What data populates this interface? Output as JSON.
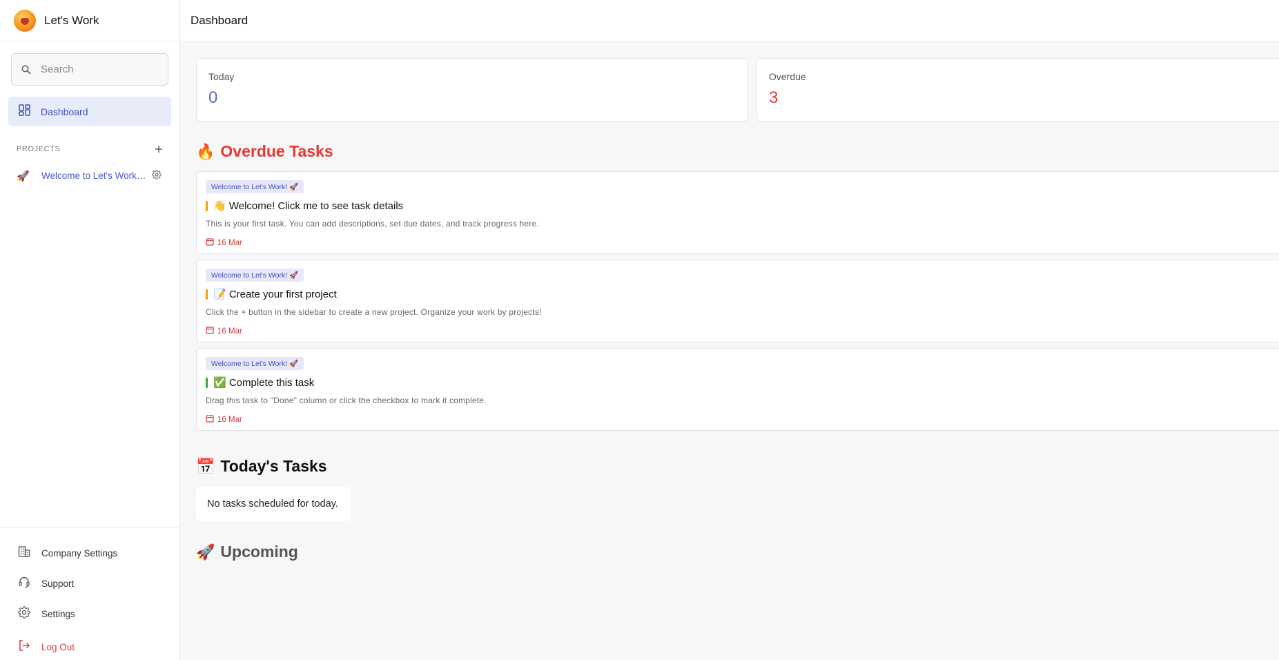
{
  "app": {
    "name": "Let's Work"
  },
  "header": {
    "title": "Dashboard"
  },
  "sidebar": {
    "search_placeholder": "Search",
    "nav": {
      "dashboard": "Dashboard"
    },
    "projects_label": "PROJECTS",
    "projects": [
      {
        "emoji": "🚀",
        "name": "Welcome to Let's Work! 🚀"
      }
    ],
    "bottom": {
      "company_settings": "Company Settings",
      "support": "Support",
      "settings": "Settings",
      "logout": "Log Out"
    }
  },
  "stats": {
    "today": {
      "label": "Today",
      "value": "0"
    },
    "overdue": {
      "label": "Overdue",
      "value": "3"
    }
  },
  "sections": {
    "overdue": {
      "emoji": "🔥",
      "title": "Overdue Tasks"
    },
    "today": {
      "emoji": "📅",
      "title": "Today's Tasks",
      "empty": "No tasks scheduled for today."
    },
    "upcoming": {
      "emoji": "🚀",
      "title": "Upcoming"
    }
  },
  "overdue_tasks": [
    {
      "project": "Welcome to Let's Work! 🚀",
      "title": "👋 Welcome! Click me to see task details",
      "description": "This is your first task. You can add descriptions, set due dates, and track progress here.",
      "due": "16 Mar",
      "priority_color": "#f59e0b"
    },
    {
      "project": "Welcome to Let's Work! 🚀",
      "title": "📝 Create your first project",
      "description": "Click the + button in the sidebar to create a new project. Organize your work by projects!",
      "due": "16 Mar",
      "priority_color": "#f59e0b"
    },
    {
      "project": "Welcome to Let's Work! 🚀",
      "title": "✅ Complete this task",
      "description": "Drag this task to \"Done\" column or click the checkbox to mark it complete.",
      "due": "16 Mar",
      "priority_color": "#43a047"
    }
  ],
  "colors": {
    "accent": "#3f51b5",
    "today_value": "#5c6bc0",
    "danger": "#e53935",
    "upcoming_title": "#555555"
  }
}
